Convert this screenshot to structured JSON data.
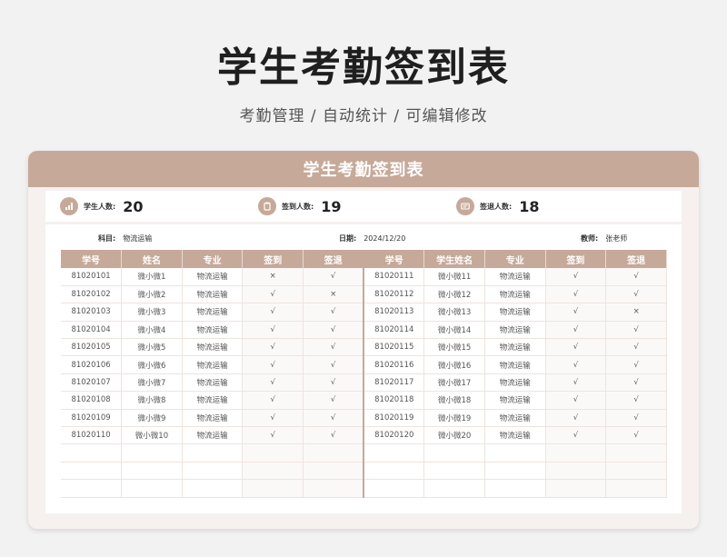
{
  "page": {
    "title": "学生考勤签到表",
    "subtitle": "考勤管理 / 自动统计 / 可编辑修改"
  },
  "card": {
    "title": "学生考勤签到表"
  },
  "stats": [
    {
      "icon": "bar-chart-icon",
      "label": "学生人数:",
      "value": "20"
    },
    {
      "icon": "clipboard-icon",
      "label": "签到人数:",
      "value": "19"
    },
    {
      "icon": "id-card-icon",
      "label": "签退人数:",
      "value": "18"
    }
  ],
  "meta": {
    "subject_label": "科目:",
    "subject_value": "物流运输",
    "date_label": "日期:",
    "date_value": "2024/12/20",
    "teacher_label": "教师:",
    "teacher_value": "张老师"
  },
  "table": {
    "headers": [
      "学号",
      "姓名",
      "专业",
      "签到",
      "签退",
      "学号",
      "学生姓名",
      "专业",
      "签到",
      "签退"
    ],
    "rows": [
      [
        "81020101",
        "微小微1",
        "物流运输",
        "×",
        "√",
        "81020111",
        "微小微11",
        "物流运输",
        "√",
        "√"
      ],
      [
        "81020102",
        "微小微2",
        "物流运输",
        "√",
        "×",
        "81020112",
        "微小微12",
        "物流运输",
        "√",
        "√"
      ],
      [
        "81020103",
        "微小微3",
        "物流运输",
        "√",
        "√",
        "81020113",
        "微小微13",
        "物流运输",
        "√",
        "×"
      ],
      [
        "81020104",
        "微小微4",
        "物流运输",
        "√",
        "√",
        "81020114",
        "微小微14",
        "物流运输",
        "√",
        "√"
      ],
      [
        "81020105",
        "微小微5",
        "物流运输",
        "√",
        "√",
        "81020115",
        "微小微15",
        "物流运输",
        "√",
        "√"
      ],
      [
        "81020106",
        "微小微6",
        "物流运输",
        "√",
        "√",
        "81020116",
        "微小微16",
        "物流运输",
        "√",
        "√"
      ],
      [
        "81020107",
        "微小微7",
        "物流运输",
        "√",
        "√",
        "81020117",
        "微小微17",
        "物流运输",
        "√",
        "√"
      ],
      [
        "81020108",
        "微小微8",
        "物流运输",
        "√",
        "√",
        "81020118",
        "微小微18",
        "物流运输",
        "√",
        "√"
      ],
      [
        "81020109",
        "微小微9",
        "物流运输",
        "√",
        "√",
        "81020119",
        "微小微19",
        "物流运输",
        "√",
        "√"
      ],
      [
        "81020110",
        "微小微10",
        "物流运输",
        "√",
        "√",
        "81020120",
        "微小微20",
        "物流运输",
        "√",
        "√"
      ],
      [
        "",
        "",
        "",
        "",
        "",
        "",
        "",
        "",
        "",
        ""
      ],
      [
        "",
        "",
        "",
        "",
        "",
        "",
        "",
        "",
        "",
        ""
      ],
      [
        "",
        "",
        "",
        "",
        "",
        "",
        "",
        "",
        "",
        ""
      ]
    ]
  },
  "colors": {
    "accent": "#c6a999",
    "background": "#f2f2f3",
    "card": "#f6f1ef"
  }
}
